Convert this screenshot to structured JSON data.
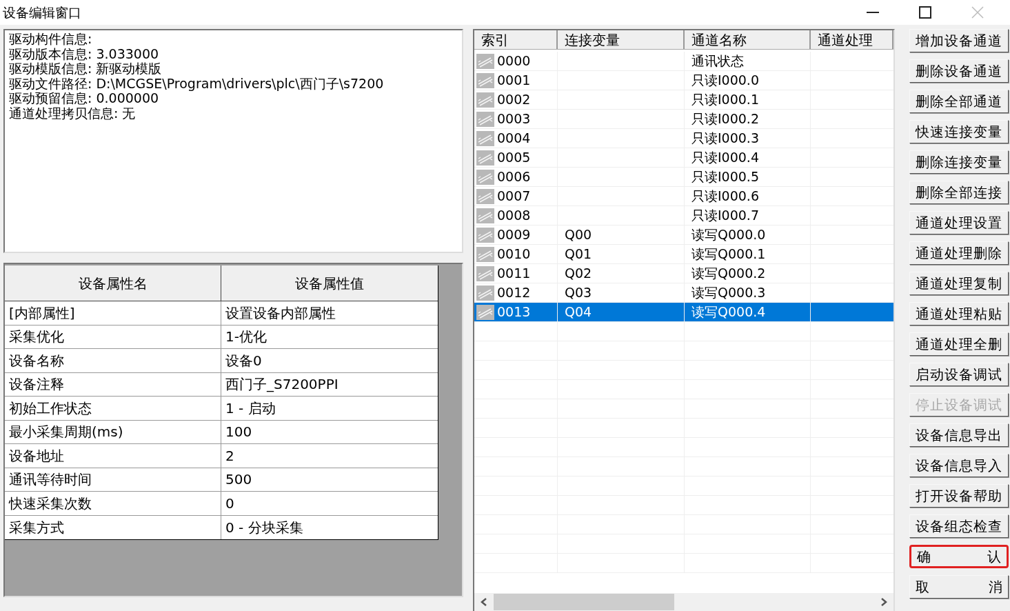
{
  "window": {
    "title": "设备编辑窗口"
  },
  "driver_info": {
    "lines": [
      "驱动构件信息:",
      "驱动版本信息: 3.033000",
      "驱动模版信息: 新驱动模版",
      "驱动文件路径: D:\\MCGSE\\Program\\drivers\\plc\\西门子\\s7200",
      "驱动预留信息: 0.000000",
      "通道处理拷贝信息: 无"
    ]
  },
  "properties": {
    "columns": [
      "设备属性名",
      "设备属性值"
    ],
    "rows": [
      {
        "name": "[内部属性]",
        "value": "设置设备内部属性"
      },
      {
        "name": "采集优化",
        "value": "1-优化"
      },
      {
        "name": "设备名称",
        "value": "设备0"
      },
      {
        "name": "设备注释",
        "value": "西门子_S7200PPI"
      },
      {
        "name": "初始工作状态",
        "value": "1 - 启动"
      },
      {
        "name": "最小采集周期(ms)",
        "value": "100"
      },
      {
        "name": "设备地址",
        "value": "2"
      },
      {
        "name": "通讯等待时间",
        "value": "500"
      },
      {
        "name": "快速采集次数",
        "value": "0"
      },
      {
        "name": "采集方式",
        "value": "0 - 分块采集"
      }
    ]
  },
  "channels": {
    "columns": [
      "索引",
      "连接变量",
      "通道名称",
      "通道处理"
    ],
    "rows": [
      {
        "index": "0000",
        "variable": "",
        "name": "通讯状态",
        "selected": false
      },
      {
        "index": "0001",
        "variable": "",
        "name": "只读I000.0",
        "selected": false
      },
      {
        "index": "0002",
        "variable": "",
        "name": "只读I000.1",
        "selected": false
      },
      {
        "index": "0003",
        "variable": "",
        "name": "只读I000.2",
        "selected": false
      },
      {
        "index": "0004",
        "variable": "",
        "name": "只读I000.3",
        "selected": false
      },
      {
        "index": "0005",
        "variable": "",
        "name": "只读I000.4",
        "selected": false
      },
      {
        "index": "0006",
        "variable": "",
        "name": "只读I000.5",
        "selected": false
      },
      {
        "index": "0007",
        "variable": "",
        "name": "只读I000.6",
        "selected": false
      },
      {
        "index": "0008",
        "variable": "",
        "name": "只读I000.7",
        "selected": false
      },
      {
        "index": "0009",
        "variable": "Q00",
        "name": "读写Q000.0",
        "selected": false
      },
      {
        "index": "0010",
        "variable": "Q01",
        "name": "读写Q000.1",
        "selected": false
      },
      {
        "index": "0011",
        "variable": "Q02",
        "name": "读写Q000.2",
        "selected": false
      },
      {
        "index": "0012",
        "variable": "Q03",
        "name": "读写Q000.3",
        "selected": false
      },
      {
        "index": "0013",
        "variable": "Q04",
        "name": "读写Q000.4",
        "selected": true
      }
    ]
  },
  "buttons": [
    {
      "kind": "normal",
      "label": "增加设备通道",
      "disabled": false,
      "highlighted": false
    },
    {
      "kind": "normal",
      "label": "删除设备通道",
      "disabled": false,
      "highlighted": false
    },
    {
      "kind": "normal",
      "label": "删除全部通道",
      "disabled": false,
      "highlighted": false
    },
    {
      "kind": "normal",
      "label": "快速连接变量",
      "disabled": false,
      "highlighted": false
    },
    {
      "kind": "normal",
      "label": "删除连接变量",
      "disabled": false,
      "highlighted": false
    },
    {
      "kind": "normal",
      "label": "删除全部连接",
      "disabled": false,
      "highlighted": false
    },
    {
      "kind": "normal",
      "label": "通道处理设置",
      "disabled": false,
      "highlighted": false
    },
    {
      "kind": "normal",
      "label": "通道处理删除",
      "disabled": false,
      "highlighted": false
    },
    {
      "kind": "normal",
      "label": "通道处理复制",
      "disabled": false,
      "highlighted": false
    },
    {
      "kind": "normal",
      "label": "通道处理粘贴",
      "disabled": false,
      "highlighted": false
    },
    {
      "kind": "normal",
      "label": "通道处理全删",
      "disabled": false,
      "highlighted": false
    },
    {
      "kind": "normal",
      "label": "启动设备调试",
      "disabled": false,
      "highlighted": false
    },
    {
      "kind": "normal",
      "label": "停止设备调试",
      "disabled": true,
      "highlighted": false
    },
    {
      "kind": "normal",
      "label": "设备信息导出",
      "disabled": false,
      "highlighted": false
    },
    {
      "kind": "normal",
      "label": "设备信息导入",
      "disabled": false,
      "highlighted": false
    },
    {
      "kind": "normal",
      "label": "打开设备帮助",
      "disabled": false,
      "highlighted": false
    },
    {
      "kind": "normal",
      "label": "设备组态检查",
      "disabled": false,
      "highlighted": false
    },
    {
      "kind": "spread",
      "parts": [
        "确",
        "认"
      ],
      "disabled": false,
      "highlighted": true
    },
    {
      "kind": "spread",
      "parts": [
        "取",
        "消"
      ],
      "disabled": false,
      "highlighted": false
    }
  ]
}
